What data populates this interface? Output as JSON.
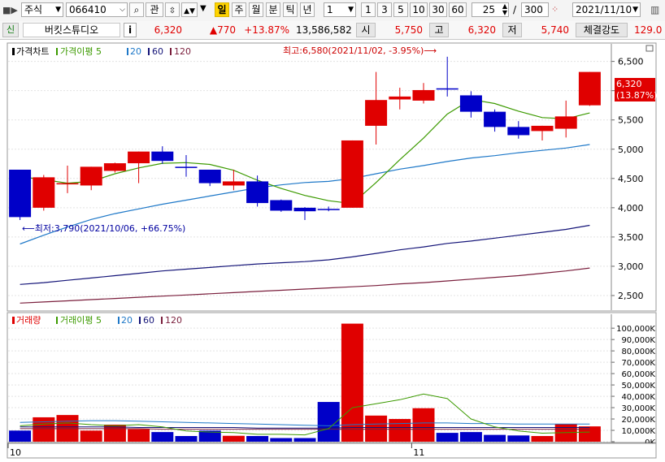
{
  "toolbar": {
    "market": "주식",
    "code": "066410",
    "watch_label": "관",
    "periods": [
      "일",
      "주",
      "월",
      "분",
      "틱",
      "년"
    ],
    "active_period": "일",
    "interval_value": "1",
    "minute_options": [
      "1",
      "3",
      "5",
      "10",
      "30",
      "60"
    ],
    "display_count": "25",
    "slash": "/",
    "total_count": "300",
    "date": "2021/11/10"
  },
  "info": {
    "credit_badge": "신",
    "name": "버킷스튜디오",
    "info_button": "i",
    "price": "6,320",
    "change": "▲770",
    "change_pct": "+13.87%",
    "volume": "13,586,582",
    "open_label": "시",
    "open": "5,750",
    "high_label": "고",
    "high": "6,320",
    "low_label": "저",
    "low": "5,740",
    "strength_label": "체결강도",
    "strength": "129.0"
  },
  "colors": {
    "up": "#e00000",
    "down": "#0000c8",
    "ma5": "#3c9a00",
    "ma20": "#1e78c8",
    "ma60": "#141478",
    "ma120": "#7a1e3c",
    "vol_ma5": "#3c9a00"
  },
  "chart_data": [
    {
      "type": "candlestick",
      "legend": [
        {
          "label": "가격차트"
        },
        {
          "label": "가격이평 5",
          "color": "#3c9a00"
        },
        {
          "label": "20",
          "color": "#1e78c8"
        },
        {
          "label": "60",
          "color": "#141478"
        },
        {
          "label": "120",
          "color": "#7a1e3c"
        }
      ],
      "ylim": [
        2250,
        6800
      ],
      "y_ticks": [
        "6,500",
        "6,000",
        "5,500",
        "5,000",
        "4,500",
        "4,000",
        "3,500",
        "3,000",
        "2,500"
      ],
      "x_ticks": [
        "10",
        "11"
      ],
      "current_price_label": "6,320",
      "current_pct_label": "(13.87%)",
      "high_annotation": "최고:6,580(2021/11/02, -3.95%)⟶",
      "low_annotation": "⟵최저:3,790(2021/10/06, +66.75%)",
      "candles": [
        {
          "o": 4650,
          "h": 4650,
          "l": 3790,
          "c": 3840
        },
        {
          "o": 4000,
          "h": 4560,
          "l": 3950,
          "c": 4520
        },
        {
          "o": 4400,
          "h": 4720,
          "l": 4250,
          "c": 4420
        },
        {
          "o": 4380,
          "h": 4700,
          "l": 4300,
          "c": 4700
        },
        {
          "o": 4630,
          "h": 4770,
          "l": 4600,
          "c": 4760
        },
        {
          "o": 4760,
          "h": 4960,
          "l": 4420,
          "c": 4960
        },
        {
          "o": 4960,
          "h": 5050,
          "l": 4750,
          "c": 4800
        },
        {
          "o": 4700,
          "h": 4900,
          "l": 4530,
          "c": 4680
        },
        {
          "o": 4650,
          "h": 4650,
          "l": 4370,
          "c": 4420
        },
        {
          "o": 4380,
          "h": 4650,
          "l": 4300,
          "c": 4450
        },
        {
          "o": 4450,
          "h": 4550,
          "l": 4020,
          "c": 4080
        },
        {
          "o": 4130,
          "h": 4140,
          "l": 3930,
          "c": 3950
        },
        {
          "o": 4000,
          "h": 4010,
          "l": 3790,
          "c": 3940
        },
        {
          "o": 3980,
          "h": 4020,
          "l": 3940,
          "c": 3960
        },
        {
          "o": 4000,
          "h": 5150,
          "l": 4000,
          "c": 5150
        },
        {
          "o": 5400,
          "h": 6320,
          "l": 5080,
          "c": 5840
        },
        {
          "o": 5850,
          "h": 6050,
          "l": 5680,
          "c": 5900
        },
        {
          "o": 5830,
          "h": 6130,
          "l": 5780,
          "c": 6010
        },
        {
          "o": 6040,
          "h": 6580,
          "l": 5900,
          "c": 6030
        },
        {
          "o": 5920,
          "h": 5990,
          "l": 5540,
          "c": 5640
        },
        {
          "o": 5640,
          "h": 5680,
          "l": 5300,
          "c": 5380
        },
        {
          "o": 5380,
          "h": 5480,
          "l": 5180,
          "c": 5240
        },
        {
          "o": 5310,
          "h": 5400,
          "l": 5150,
          "c": 5400
        },
        {
          "o": 5350,
          "h": 5830,
          "l": 5200,
          "c": 5560
        },
        {
          "o": 5750,
          "h": 6320,
          "l": 5740,
          "c": 6320
        }
      ],
      "ma5": [
        4530,
        4480,
        4420,
        4450,
        4580,
        4680,
        4760,
        4770,
        4740,
        4640,
        4470,
        4330,
        4210,
        4120,
        4070,
        4430,
        4820,
        5190,
        5600,
        5850,
        5780,
        5650,
        5540,
        5520,
        5620
      ],
      "ma20": [
        3380,
        3530,
        3670,
        3800,
        3900,
        3980,
        4060,
        4130,
        4200,
        4270,
        4340,
        4390,
        4430,
        4450,
        4500,
        4580,
        4660,
        4720,
        4790,
        4850,
        4890,
        4940,
        4980,
        5020,
        5080
      ],
      "ma60": [
        2690,
        2720,
        2760,
        2800,
        2840,
        2880,
        2920,
        2950,
        2980,
        3010,
        3040,
        3060,
        3080,
        3110,
        3160,
        3220,
        3280,
        3330,
        3390,
        3430,
        3480,
        3530,
        3580,
        3630,
        3700
      ],
      "ma120": [
        2370,
        2390,
        2410,
        2430,
        2450,
        2470,
        2490,
        2510,
        2530,
        2550,
        2570,
        2590,
        2610,
        2630,
        2650,
        2670,
        2700,
        2720,
        2750,
        2780,
        2810,
        2840,
        2880,
        2920,
        2970
      ]
    },
    {
      "type": "bar",
      "legend": [
        {
          "label": "거래량"
        },
        {
          "label": "거래이평 5",
          "color": "#3c9a00"
        },
        {
          "label": "20",
          "color": "#1e78c8"
        },
        {
          "label": "60",
          "color": "#141478"
        },
        {
          "label": "120",
          "color": "#7a1e3c"
        }
      ],
      "ylim": [
        0,
        108000
      ],
      "y_ticks": [
        "100,000K",
        "90,000K",
        "80,000K",
        "70,000K",
        "60,000K",
        "50,000K",
        "40,000K",
        "30,000K",
        "20,000K",
        "10,000K",
        "0K"
      ],
      "x_ticks": [
        "10",
        "11"
      ],
      "volumes": [
        9800,
        21500,
        23500,
        9800,
        15000,
        11000,
        8500,
        5000,
        9800,
        5200,
        5000,
        3200,
        3200,
        35000,
        104000,
        23000,
        20000,
        29500,
        7800,
        8500,
        6000,
        5500,
        5000,
        15500,
        13500
      ],
      "ma5": [
        14000,
        15500,
        16500,
        15000,
        14000,
        15000,
        13000,
        9500,
        8500,
        8000,
        6500,
        6500,
        6000,
        11500,
        30000,
        33500,
        37000,
        42000,
        38000,
        20000,
        13000,
        9500,
        7500,
        8000,
        8500
      ],
      "ma20": [
        17000,
        17500,
        18000,
        18500,
        18500,
        18000,
        17500,
        17000,
        16500,
        16000,
        15500,
        15000,
        14500,
        14000,
        15000,
        15500,
        16000,
        16500,
        16500,
        16000,
        16000,
        15500,
        15500,
        15500,
        15500
      ],
      "ma60": [
        13000,
        13000,
        13000,
        13000,
        13000,
        12500,
        12500,
        12500,
        12500,
        12500,
        12000,
        12000,
        12000,
        12000,
        12500,
        12500,
        12500,
        12500,
        12500,
        12500,
        12500,
        12500,
        12500,
        12500,
        12500
      ],
      "ma120": [
        11500,
        11500,
        11500,
        11500,
        11500,
        11500,
        11000,
        11000,
        11000,
        11000,
        11000,
        11000,
        11000,
        11000,
        11000,
        11000,
        11000,
        11000,
        11000,
        11000,
        11000,
        11000,
        11000,
        11000,
        11000
      ]
    }
  ]
}
